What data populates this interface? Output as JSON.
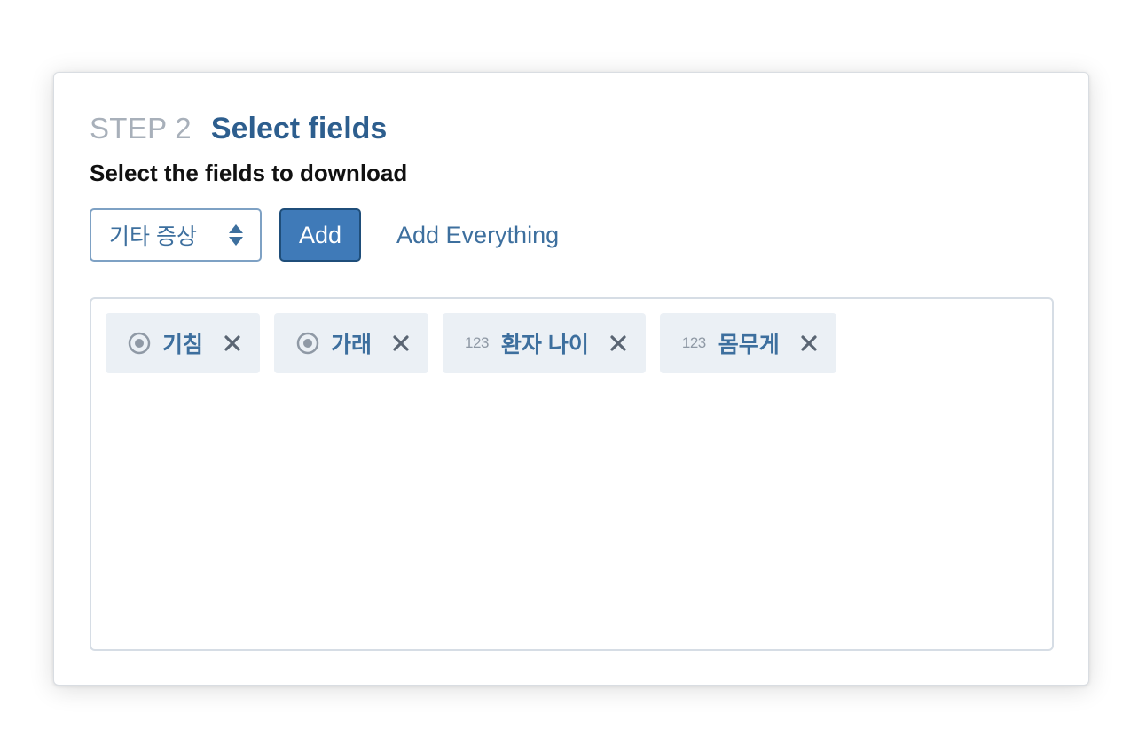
{
  "step": {
    "label": "STEP 2",
    "title": "Select fields"
  },
  "subtitle": "Select the fields to download",
  "controls": {
    "select_value": "기타 증상",
    "select_icon": "sort-arrows-icon",
    "add_label": "Add",
    "add_everything_label": "Add Everything"
  },
  "fields": [
    {
      "type_icon": "radio-icon",
      "type_text": "",
      "label": "기침"
    },
    {
      "type_icon": "radio-icon",
      "type_text": "",
      "label": "가래"
    },
    {
      "type_icon": "number-icon",
      "type_text": "123",
      "label": "환자 나이"
    },
    {
      "type_icon": "number-icon",
      "type_text": "123",
      "label": "몸무게"
    }
  ],
  "colors": {
    "accent": "#3d6f9e",
    "heading": "#2d5e8e",
    "step_muted": "#a8b0ba",
    "button_bg": "#3f7ab8",
    "chip_bg": "#ebf0f5",
    "remove_icon": "#5a6573"
  }
}
